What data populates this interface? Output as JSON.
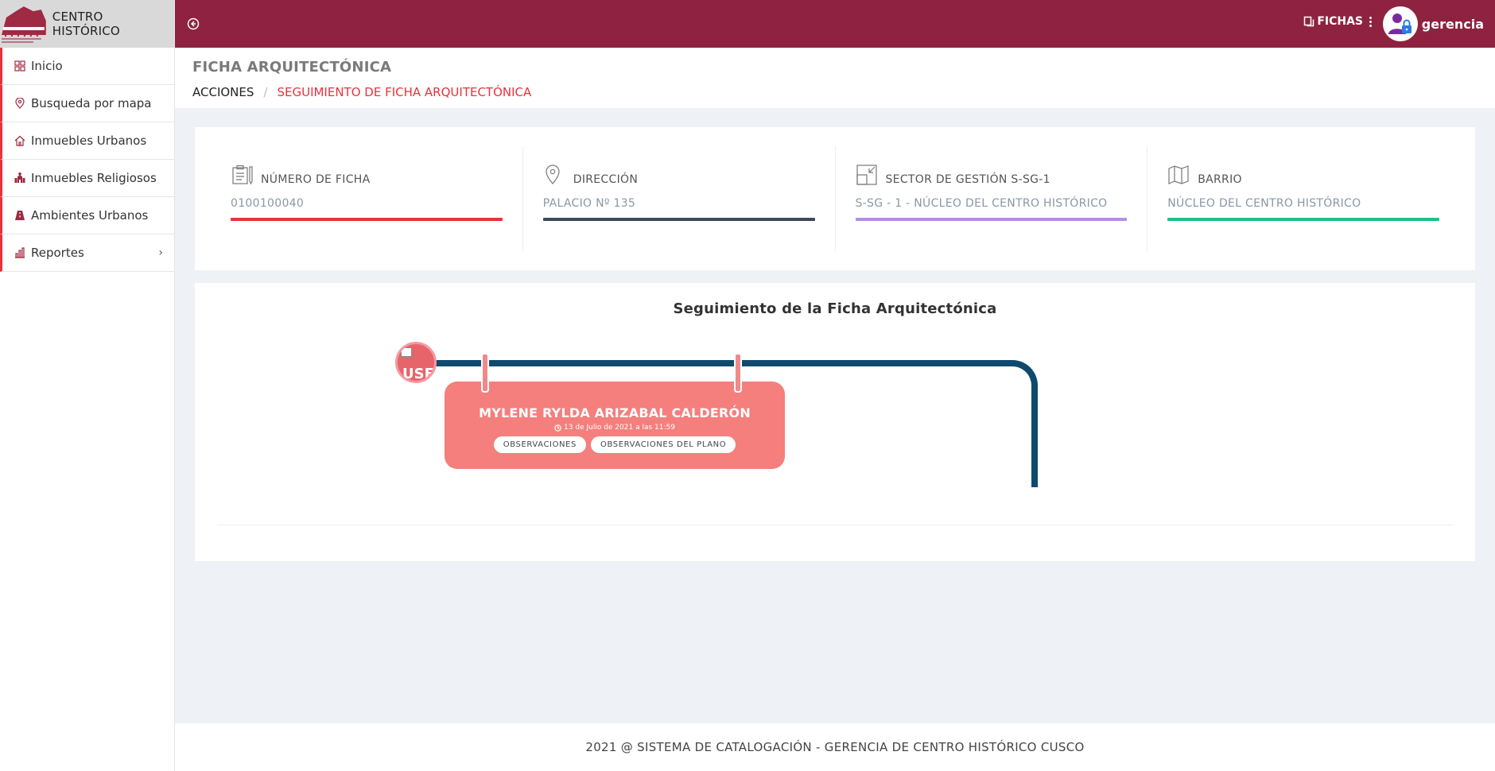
{
  "brand": {
    "title": "CENTRO HISTÓRICO"
  },
  "sidebar": {
    "items": [
      {
        "label": "Inicio",
        "icon": "grid-icon"
      },
      {
        "label": "Busqueda por mapa",
        "icon": "map-pin-icon"
      },
      {
        "label": "Inmuebles Urbanos",
        "icon": "home-icon"
      },
      {
        "label": "Inmuebles Religiosos",
        "icon": "church-icon"
      },
      {
        "label": "Ambientes Urbanos",
        "icon": "road-icon"
      },
      {
        "label": "Reportes",
        "icon": "bar-chart-icon",
        "has_submenu": true
      }
    ]
  },
  "topbar": {
    "fichas_label": "FICHAS",
    "user_name": "gerencia"
  },
  "header": {
    "title": "FICHA ARQUITECTÓNICA",
    "breadcrumb": {
      "root": "ACCIONES",
      "separator": "/",
      "active": "SEGUIMIENTO DE FICHA ARQUITECTÓNICA"
    }
  },
  "info": {
    "numero": {
      "label": "NÚMERO DE FICHA",
      "value": "0100100040",
      "color": "#e8323c"
    },
    "direccion": {
      "label": "DIRECCIÓN",
      "value": "PALACIO Nº 135",
      "color": "#3d4a5c"
    },
    "sector": {
      "label": "SECTOR DE GESTIÓN S-SG-1",
      "value": "S-SG - 1 - NÚCLEO DEL CENTRO HISTÓRICO",
      "color": "#b48ee0"
    },
    "barrio": {
      "label": "BARRIO",
      "value": "NÚCLEO DEL CENTRO HISTÓRICO",
      "color": "#1dbf8a"
    }
  },
  "timeline": {
    "title": "Seguimiento de la Ficha Arquitectónica",
    "avatar_text": "USE",
    "event": {
      "name": "MYLENE RYLDA ARIZABAL CALDERÓN",
      "date": "13 de Julio de 2021 a las 11:59",
      "btn_observaciones": "OBSERVACIONES",
      "btn_observaciones_plano": "OBSERVACIONES DEL PLANO"
    }
  },
  "colors": {
    "primary": "#8e2240",
    "accent": "#e8323c",
    "event": "#f47f7d",
    "track": "#0f4a6e"
  },
  "footer": {
    "text": "2021 @ SISTEMA DE CATALOGACIÓN - GERENCIA DE CENTRO HISTÓRICO CUSCO"
  }
}
